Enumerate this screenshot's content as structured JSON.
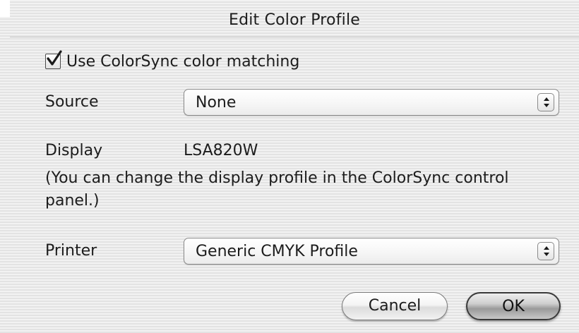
{
  "dialog": {
    "title": "Edit Color Profile"
  },
  "colorsync": {
    "label": "Use ColorSync color matching",
    "checked": true,
    "icon": "checkmark-icon"
  },
  "source": {
    "label": "Source",
    "value": "None",
    "icon": "up-down-arrows-icon"
  },
  "display": {
    "label": "Display",
    "value": "LSA820W",
    "note": "(You can change the display profile in the ColorSync control panel.)"
  },
  "printer": {
    "label": "Printer",
    "value": "Generic CMYK Profile",
    "icon": "up-down-arrows-icon"
  },
  "buttons": {
    "cancel": "Cancel",
    "ok": "OK"
  }
}
